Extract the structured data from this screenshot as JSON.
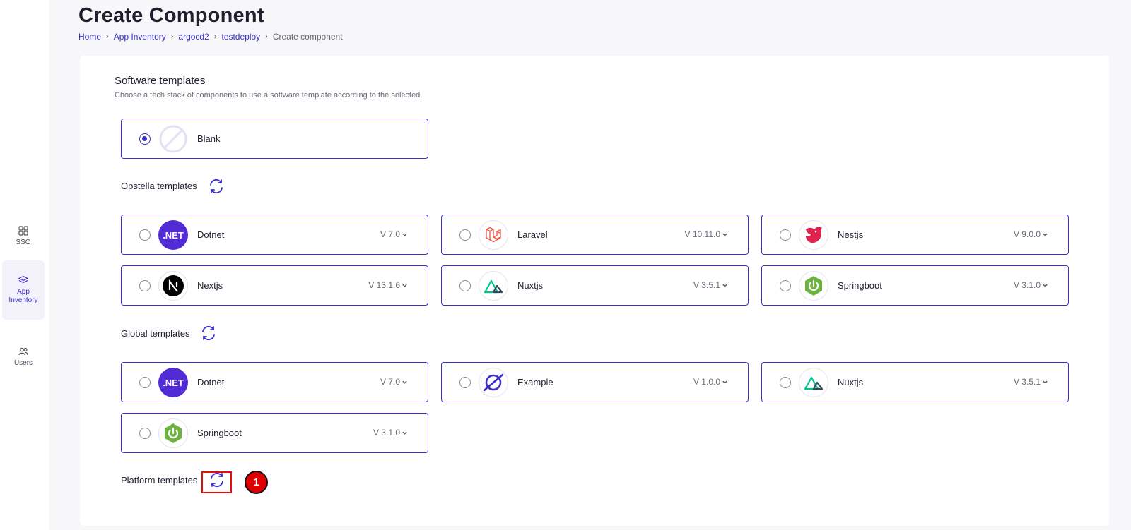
{
  "sidebar": {
    "items": [
      {
        "label": "SSO",
        "icon": "grid-icon"
      },
      {
        "label": "App Inventory",
        "icon": "layers-icon",
        "active": true
      },
      {
        "label": "Users",
        "icon": "users-icon"
      }
    ]
  },
  "header": {
    "title": "Create Component",
    "breadcrumb": [
      "Home",
      "App Inventory",
      "argocd2",
      "testdeploy",
      "Create component"
    ]
  },
  "software_templates": {
    "title": "Software templates",
    "description": "Choose a tech stack of components to use a software template according to the selected.",
    "blank": {
      "name": "Blank",
      "selected": true
    }
  },
  "groups": {
    "opstella": {
      "title": "Opstella templates",
      "items": [
        {
          "name": "Dotnet",
          "version": "V 7.0",
          "logo": "dotnet-logo"
        },
        {
          "name": "Laravel",
          "version": "V 10.11.0",
          "logo": "laravel-logo"
        },
        {
          "name": "Nestjs",
          "version": "V 9.0.0",
          "logo": "nestjs-logo"
        },
        {
          "name": "Nextjs",
          "version": "V 13.1.6",
          "logo": "nextjs-logo"
        },
        {
          "name": "Nuxtjs",
          "version": "V 3.5.1",
          "logo": "nuxtjs-logo"
        },
        {
          "name": "Springboot",
          "version": "V 3.1.0",
          "logo": "springboot-logo"
        }
      ]
    },
    "global": {
      "title": "Global templates",
      "items": [
        {
          "name": "Dotnet",
          "version": "V 7.0",
          "logo": "dotnet-logo"
        },
        {
          "name": "Example",
          "version": "V 1.0.0",
          "logo": "example-logo"
        },
        {
          "name": "Nuxtjs",
          "version": "V 3.5.1",
          "logo": "nuxtjs-logo"
        },
        {
          "name": "Springboot",
          "version": "V 3.1.0",
          "logo": "springboot-logo"
        }
      ]
    },
    "platform": {
      "title": "Platform templates"
    }
  },
  "annotation": {
    "marker": "1"
  },
  "colors": {
    "accent": "#3b2fc9",
    "highlight": "#e01010"
  }
}
